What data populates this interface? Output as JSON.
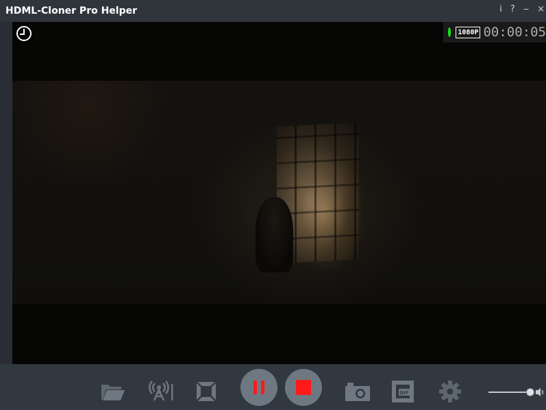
{
  "window": {
    "title": "HDML-Cloner Pro Helper",
    "buttons": {
      "info": "i",
      "help": "?",
      "minimize": "‒",
      "close": "×"
    }
  },
  "status": {
    "recording_indicator_color": "#19e619",
    "resolution": "1080P",
    "timer": "00:00:05"
  },
  "toolbar": {
    "icons": [
      "folder-icon",
      "broadcast-icon",
      "fullscreen-icon",
      "pause-icon",
      "stop-icon",
      "camera-icon",
      "gif-icon",
      "gear-icon",
      "volume-icon"
    ],
    "gif_label": "GIF",
    "volume_level": 1.0
  },
  "colors": {
    "accent_red": "#ff1a1a",
    "toolbar_bg": "#323840",
    "title_bg": "#30353b"
  }
}
